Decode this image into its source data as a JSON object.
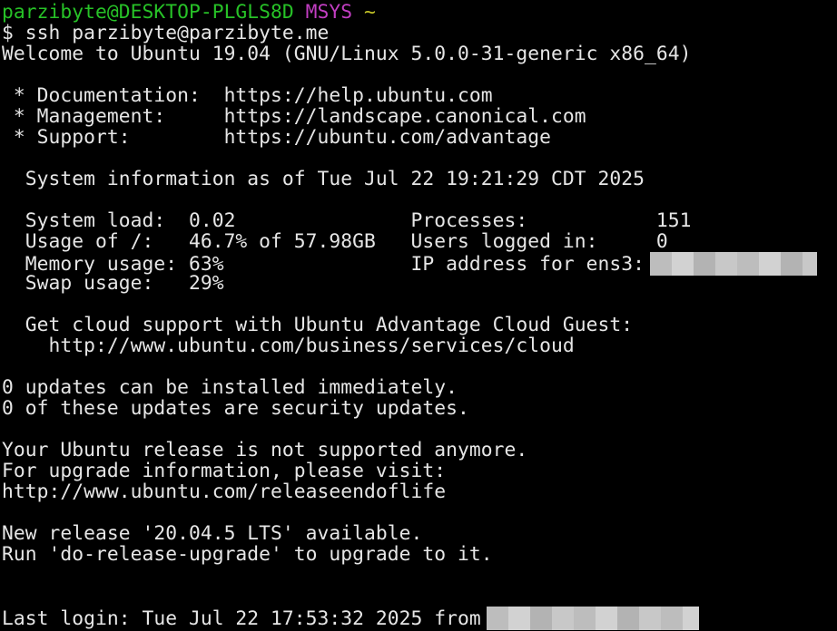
{
  "prompt": {
    "user_host": "parzibyte@DESKTOP-PLGLS8D",
    "env": "MSYS",
    "cwd": "~"
  },
  "command_line": {
    "dollar": "$",
    "command": "ssh parzibyte@parzibyte.me"
  },
  "welcome": "Welcome to Ubuntu 19.04 (GNU/Linux 5.0.0-31-generic x86_64)",
  "help_links": [
    " * Documentation:  https://help.ubuntu.com",
    " * Management:     https://landscape.canonical.com",
    " * Support:        https://ubuntu.com/advantage"
  ],
  "sysinfo_header": "  System information as of Tue Jul 22 19:21:29 CDT 2025",
  "sysinfo_rows": [
    "  System load:  0.02               Processes:           151",
    "  Usage of /:   46.7% of 57.98GB   Users logged in:     0",
    "  Memory usage: 63%                IP address for ens3:",
    "  Swap usage:   29%"
  ],
  "cloud": [
    "  Get cloud support with Ubuntu Advantage Cloud Guest:",
    "    http://www.ubuntu.com/business/services/cloud"
  ],
  "updates": [
    "0 updates can be installed immediately.",
    "0 of these updates are security updates."
  ],
  "release_notice": [
    "Your Ubuntu release is not supported anymore.",
    "For upgrade information, please visit:",
    "http://www.ubuntu.com/releaseendoflife"
  ],
  "new_release": [
    "New release '20.04.5 LTS' available.",
    "Run 'do-release-upgrade' to upgrade to it."
  ],
  "last_login": "Last login: Tue Jul 22 17:53:32 2025 from",
  "colors": {
    "background": "#000000",
    "foreground": "#e6e6e6",
    "prompt_user": "#27c227",
    "prompt_env": "#c23ec2",
    "prompt_cwd": "#c2c227"
  }
}
